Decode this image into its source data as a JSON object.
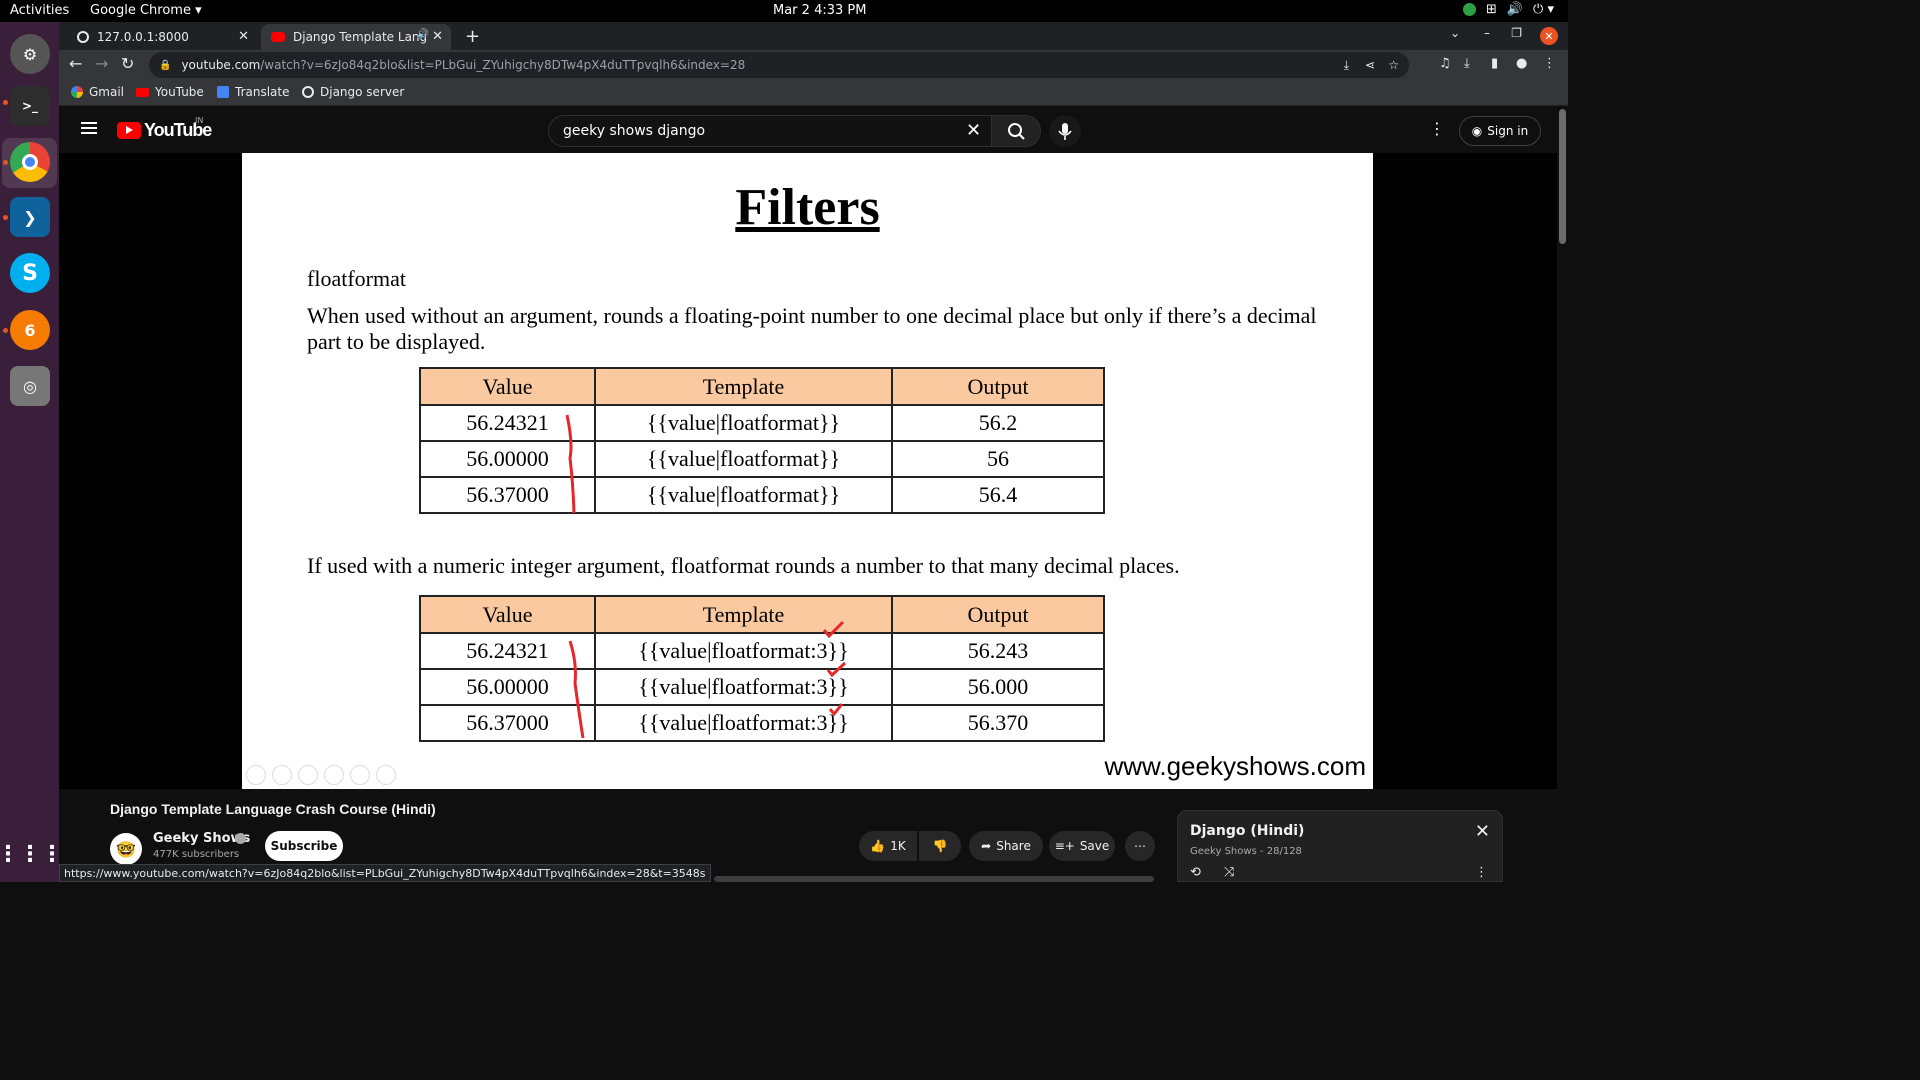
{
  "system": {
    "activities": "Activities",
    "app_menu": "Google Chrome",
    "clock": "Mar 2  4:33 PM"
  },
  "browser": {
    "tabs": [
      {
        "title": "127.0.0.1:8000"
      },
      {
        "title": "Django Template Lang"
      }
    ],
    "url_host": "youtube.com",
    "url_rest": "/watch?v=6zJo84q2blo&list=PLbGui_ZYuhigchy8DTw4pX4duTTpvqlh6&index=28",
    "bookmarks": [
      "Gmail",
      "YouTube",
      "Translate",
      "Django server"
    ],
    "status_url": "https://www.youtube.com/watch?v=6zJo84q2blo&list=PLbGui_ZYuhigchy8DTw4pX4duTTpvqlh6&index=28&t=3548s"
  },
  "youtube": {
    "logo": "YouTube",
    "country": "IN",
    "search_query": "geeky shows django",
    "sign_in": "Sign in"
  },
  "slide": {
    "title": "Filters",
    "subhead": "floatformat",
    "para1": "When used without an argument, rounds a floating-point number to one decimal place but only if there’s a decimal part to be displayed.",
    "para2": "If used with a numeric integer argument, floatformat rounds a number to that many decimal places.",
    "headers": [
      "Value",
      "Template",
      "Output"
    ],
    "table1": [
      [
        "56.24321",
        "{{value|floatformat}}",
        "56.2"
      ],
      [
        "56.00000",
        "{{value|floatformat}}",
        "56"
      ],
      [
        "56.37000",
        "{{value|floatformat}}",
        "56.4"
      ]
    ],
    "table2": [
      [
        "56.24321",
        "{{value|floatformat:3}}",
        "56.243"
      ],
      [
        "56.00000",
        "{{value|floatformat:3}}",
        "56.000"
      ],
      [
        "56.37000",
        "{{value|floatformat:3}}",
        "56.370"
      ]
    ],
    "watermark": "www.geekyshows.com",
    "header_color": "#fbc9a0",
    "annotation_color": "#e5262b"
  },
  "video": {
    "title": "Django Template Language Crash Course (Hindi)",
    "channel": "Geeky Shows",
    "subscribers": "477K subscribers",
    "subscribe": "Subscribe",
    "likes": "1K",
    "share": "Share",
    "save": "Save"
  },
  "playlist": {
    "title": "Django (Hindi)",
    "meta": "Geeky Shows - 28/128"
  }
}
